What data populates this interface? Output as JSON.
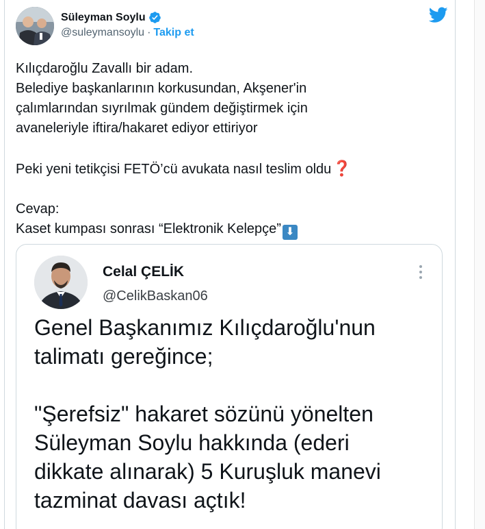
{
  "tweet": {
    "author_name": "Süleyman Soylu",
    "author_handle": "@suleymansoylu",
    "separator": "·",
    "follow_label": "Takip et",
    "lines": [
      "Kılıçdaroğlu Zavallı bir adam.",
      "Belediye başkanlarının korkusundan, Akşener'in",
      "çalımlarından sıyrılmak gündem değiştirmek için",
      "avaneleriyle iftira/hakaret ediyor ettiriyor",
      "",
      "Peki yeni tetikçisi FETÖ’cü avukata nasıl teslim oldu",
      "",
      "Cevap:",
      "Kaset kumpası sonrası “Elektronik Kelepçe”"
    ],
    "icons": {
      "verified": "verified-badge-icon",
      "platform": "twitter-bird-icon",
      "question_emoji": "red-question-mark-icon",
      "down_emoji": "down-arrow-button-icon"
    },
    "colors": {
      "accent": "#1d9bf0",
      "text": "#0f1419",
      "muted": "#536471"
    }
  },
  "quoted_tweet": {
    "author_name": "Celal ÇELİK",
    "author_handle": "@CelikBaskan06",
    "lines": [
      "Genel Başkanımız Kılıçdaroğlu'nun",
      "talimatı gereğince;",
      "",
      "\"Şerefsiz\" hakaret sözünü yönelten",
      "Süleyman Soylu hakkında (ederi",
      "dikkate alınarak) 5 Kuruşluk manevi",
      "tazminat davası açtık!"
    ],
    "more_icon": "more-vertical-icon"
  }
}
